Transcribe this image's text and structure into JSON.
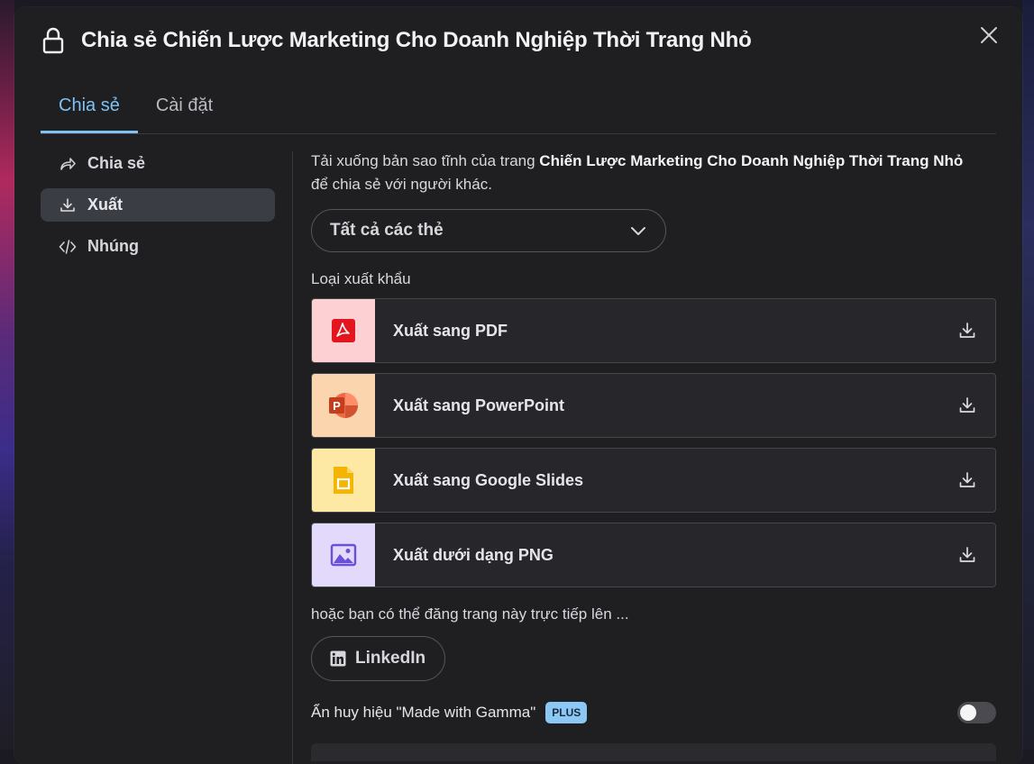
{
  "header": {
    "title": "Chia sẻ Chiến Lược Marketing Cho Doanh Nghiệp Thời Trang Nhỏ",
    "lock_icon": "lock-icon",
    "close_icon": "close-icon"
  },
  "tabs": [
    {
      "label": "Chia sẻ",
      "active": true
    },
    {
      "label": "Cài đặt",
      "active": false
    }
  ],
  "sidebar": {
    "items": [
      {
        "label": "Chia sẻ",
        "icon": "share-icon",
        "active": false
      },
      {
        "label": "Xuất",
        "icon": "download-icon",
        "active": true
      },
      {
        "label": "Nhúng",
        "icon": "code-icon",
        "active": false
      }
    ]
  },
  "export": {
    "desc_prefix": "Tải xuống bản sao tĩnh của trang ",
    "desc_doc": "Chiến Lược Marketing Cho Doanh Nghiệp Thời Trang Nhỏ",
    "desc_suffix": "để chia sẻ với người khác.",
    "select_value": "Tất cả các thẻ",
    "section_label": "Loại xuất khẩu",
    "items": [
      {
        "label": "Xuất sang PDF",
        "icon": "pdf-icon",
        "bg": "#fdd0d3"
      },
      {
        "label": "Xuất sang PowerPoint",
        "icon": "powerpoint-icon",
        "bg": "#fbd5ad"
      },
      {
        "label": "Xuất sang Google Slides",
        "icon": "google-slides-icon",
        "bg": "#fde9a3"
      },
      {
        "label": "Xuất dưới dạng PNG",
        "icon": "image-icon",
        "bg": "#e2d9fb"
      }
    ],
    "or_text": "hoặc bạn có thể đăng trang này trực tiếp lên ...",
    "linkedin_label": "LinkedIn",
    "badge_text": "Ẩn huy hiệu \"Made with Gamma\"",
    "plus_label": "PLUS",
    "toggle_on": false
  },
  "colors": {
    "accent": "#7fc1f2",
    "modal_bg": "#1f1f22",
    "plus_badge": "#8cc8f5"
  }
}
